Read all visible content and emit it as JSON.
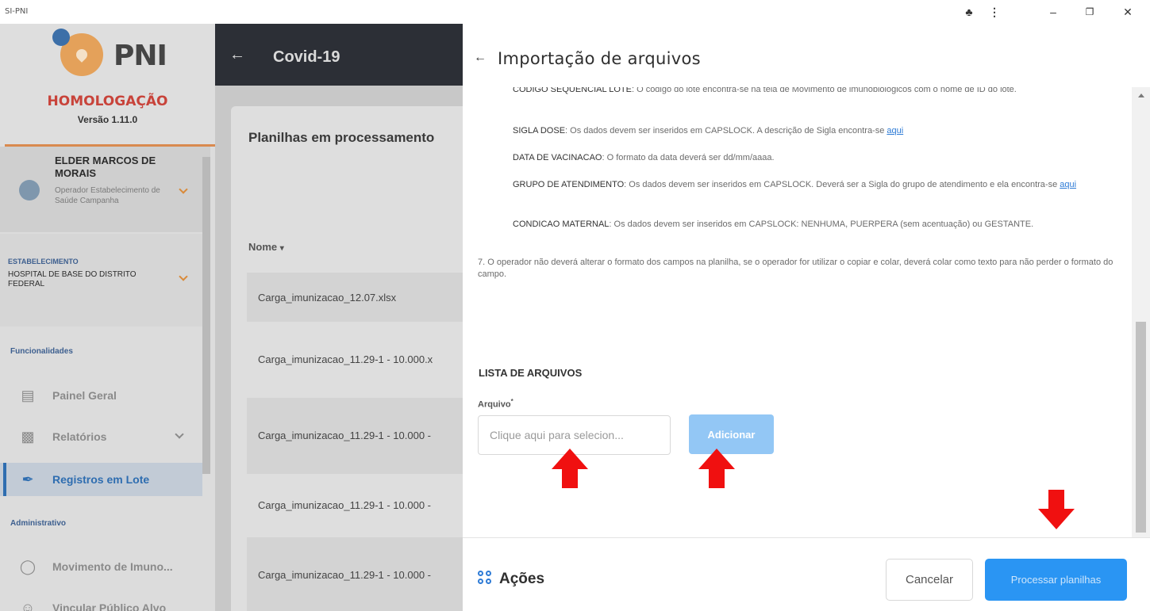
{
  "window": {
    "title": "SI-PNI",
    "controls": [
      "puzzle-icon",
      "more-vert-icon",
      "minimize-icon",
      "restore-icon",
      "close-icon"
    ]
  },
  "sidebar": {
    "logo_text": "PNI",
    "environment": "HOMOLOGAÇÃO",
    "version": "Versão 1.11.0",
    "user": {
      "name": "ELDER MARCOS DE MORAIS",
      "role": "Operador Estabelecimento de Saúde Campanha"
    },
    "establishment": {
      "label": "ESTABELECIMENTO",
      "value": "HOSPITAL DE BASE DO DISTRITO FEDERAL"
    },
    "sections": {
      "funcionalidades": "Funcionalidades",
      "administrativo": "Administrativo"
    },
    "items": [
      {
        "label": "Painel Geral",
        "icon": "monitor-icon"
      },
      {
        "label": "Relatórios",
        "icon": "report-chart-icon"
      },
      {
        "label": "Registros em Lote",
        "icon": "syringe-icon"
      },
      {
        "label": "Movimento de Imuno...",
        "icon": "hand-drop-icon"
      },
      {
        "label": "Vincular Público Alvo",
        "icon": "person-icon"
      }
    ]
  },
  "main": {
    "title": "Covid-19",
    "card_title": "Planilhas em processamento",
    "table_header": "Nome",
    "rows": [
      "Carga_imunizacao_12.07.xlsx",
      "Carga_imunizacao_11.29-1 - 10.000.x",
      "Carga_imunizacao_11.29-1 - 10.000 -",
      "Carga_imunizacao_11.29-1 - 10.000 -",
      "Carga_imunizacao_11.29-1 - 10.000 -"
    ]
  },
  "dialog": {
    "title": "Importação de arquivos",
    "instructions": {
      "codigo_label": "CODIGO SEQUENCIAL LOTE",
      "codigo_text": ": O código do lote encontra-se na tela de Movimento de imunobiológicos com o nome de ID do lote.",
      "sigla_label": "SIGLA DOSE",
      "sigla_text": ": Os dados devem ser inseridos em CAPSLOCK. A descrição de Sigla encontra-se ",
      "link": "aqui",
      "data_label": "DATA DE VACINACAO",
      "data_text": ": O formato da data deverá ser dd/mm/aaaa.",
      "grupo_label": "GRUPO DE ATENDIMENTO",
      "grupo_text": ": Os dados devem ser inseridos em CAPSLOCK. Deverá ser a Sigla do grupo de atendimento e ela encontra-se ",
      "condicao_label": "CONDICAO MATERNAL",
      "condicao_text": ": Os dados devem ser inseridos em CAPSLOCK: NENHUMA, PUERPERA (sem acentuação) ou GESTANTE.",
      "item7": "7. O operador não deverá alterar o formato dos campos na planilha, se o operador for utilizar o copiar e colar, deverá colar como texto para não perder o formato do campo."
    },
    "list_title": "LISTA DE ARQUIVOS",
    "file_label": "Arquivo",
    "file_placeholder": "Clique aqui para selecion...",
    "add_button": "Adicionar",
    "actions_label": "Ações",
    "cancel_button": "Cancelar",
    "process_button": "Processar planilhas"
  },
  "colors": {
    "accent": "#2a95f3",
    "add_button": "#93c7f5",
    "annotation_arrow": "#f01010",
    "environment": "#c8433a"
  }
}
